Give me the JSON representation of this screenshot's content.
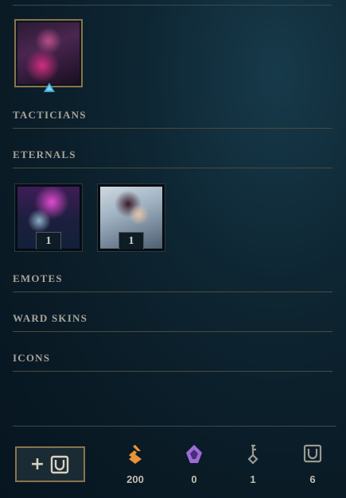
{
  "sections": {
    "tacticians": "TACTICIANS",
    "eternals": "ETERNALS",
    "emotes": "EMOTES",
    "ward_skins": "WARD SKINS",
    "icons": "ICONS"
  },
  "eternals": [
    {
      "count": "1"
    },
    {
      "count": "1"
    }
  ],
  "currencies": [
    {
      "icon": "orange-essence-icon",
      "value": "200",
      "color": "#e8943a"
    },
    {
      "icon": "mythic-essence-icon",
      "value": "0",
      "color": "#9e6bd9"
    },
    {
      "icon": "key-fragment-icon",
      "value": "1",
      "color": "#9a9a92"
    },
    {
      "icon": "capsule-icon",
      "value": "6",
      "color": "#9a9a92"
    }
  ],
  "colors": {
    "gold_border": "#8b7449",
    "background": "#0a1c27",
    "tier_gem": "#3aa8d8"
  }
}
